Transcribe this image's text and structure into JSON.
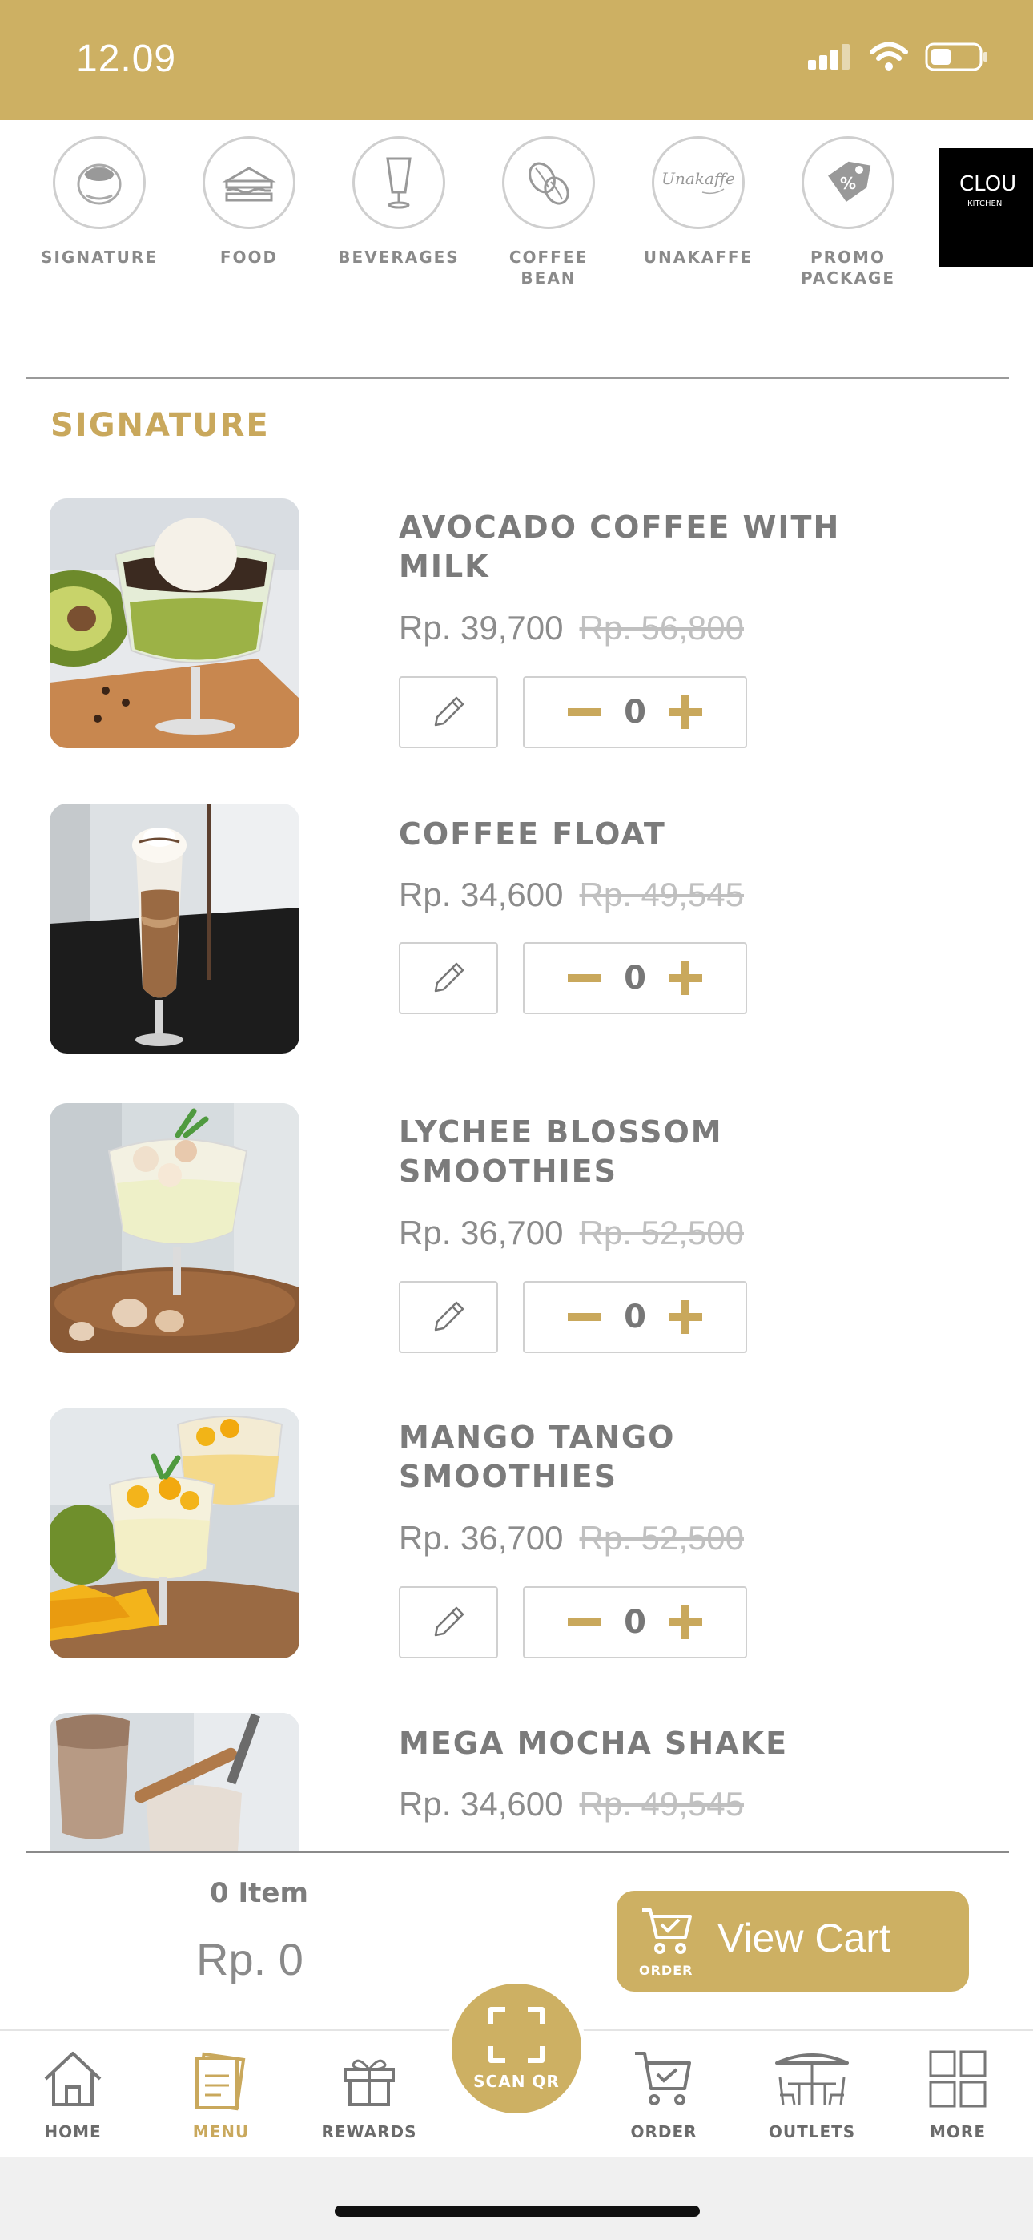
{
  "status_bar": {
    "time": "12.09"
  },
  "categories": [
    {
      "label": "SIGNATURE",
      "icon": "coffee-cup-icon"
    },
    {
      "label": "FOOD",
      "icon": "sandwich-icon"
    },
    {
      "label": "BEVERAGES",
      "icon": "glass-icon"
    },
    {
      "label": "COFFEE\nBEAN",
      "icon": "coffee-bean-icon"
    },
    {
      "label": "UNAKAFFE",
      "icon": "unakaffe-logo"
    },
    {
      "label": "PROMO\nPACKAGE",
      "icon": "promo-tag-icon"
    }
  ],
  "cloud_kitchen": {
    "title": "CLOU",
    "subtitle": "KITCHEN"
  },
  "unakaffe_logo_text": "Unakaffe",
  "section": {
    "title": "SIGNATURE"
  },
  "items": [
    {
      "name": "AVOCADO COFFEE WITH MILK",
      "price": "Rp. 39,700",
      "old_price": "Rp. 56,800",
      "qty": "0",
      "thumb": "avocado"
    },
    {
      "name": "COFFEE FLOAT",
      "price": "Rp. 34,600",
      "old_price": "Rp. 49,545",
      "qty": "0",
      "thumb": "float"
    },
    {
      "name": "LYCHEE BLOSSOM SMOOTHIES",
      "price": "Rp. 36,700",
      "old_price": "Rp. 52,500",
      "qty": "0",
      "thumb": "lychee"
    },
    {
      "name": "MANGO TANGO SMOOTHIES",
      "price": "Rp. 36,700",
      "old_price": "Rp. 52,500",
      "qty": "0",
      "thumb": "mango"
    },
    {
      "name": "MEGA MOCHA SHAKE",
      "price": "Rp. 34,600",
      "old_price": "Rp. 49,545",
      "qty": "0",
      "thumb": "mocha"
    }
  ],
  "cart": {
    "item_count": "0 Item",
    "total": "Rp. 0",
    "button_label": "View Cart",
    "order_label": "ORDER"
  },
  "tabs": [
    {
      "label": "HOME",
      "icon": "home-icon"
    },
    {
      "label": "MENU",
      "icon": "menu-icon",
      "active": true
    },
    {
      "label": "REWARDS",
      "icon": "gift-icon"
    },
    {
      "label": "ORDER",
      "icon": "cart-icon"
    },
    {
      "label": "OUTLETS",
      "icon": "outlet-icon"
    },
    {
      "label": "MORE",
      "icon": "grid-icon"
    }
  ],
  "scan": {
    "label": "SCAN QR"
  },
  "colors": {
    "gold": "#cdb063",
    "section_gold": "#c9a85c",
    "text_gray": "#7b7b7b"
  }
}
